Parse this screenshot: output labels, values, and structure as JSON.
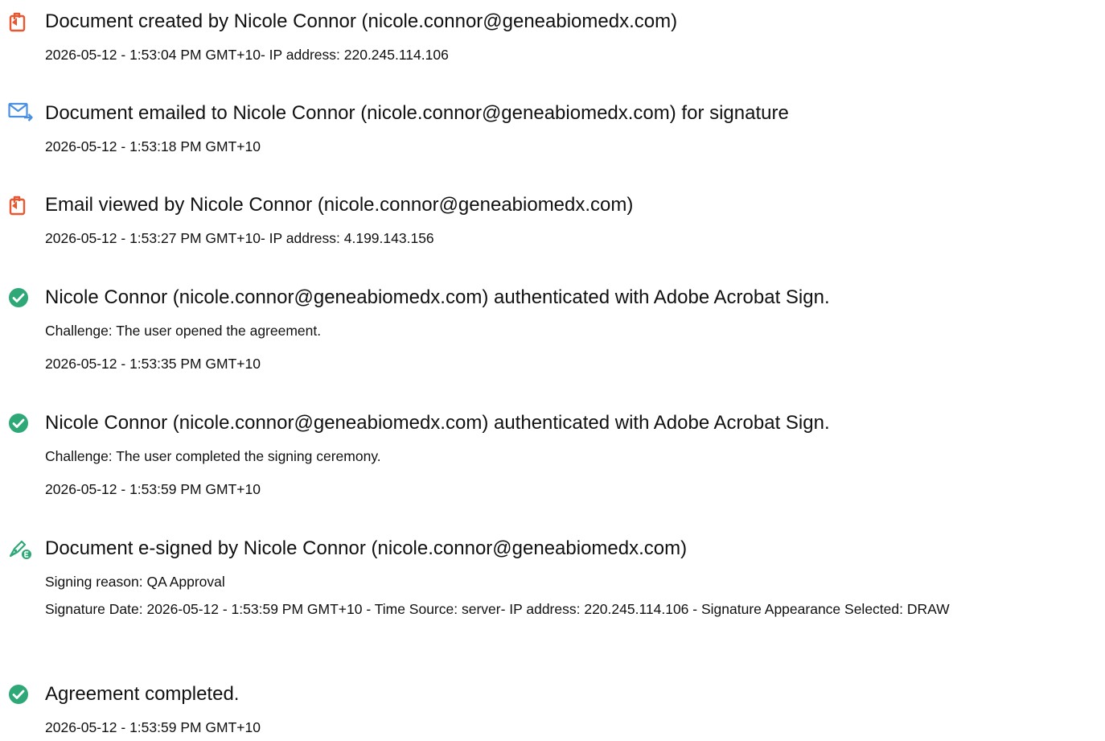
{
  "events": [
    {
      "icon": "document-created-icon",
      "title": "Document created by Nicole Connor (nicole.connor@geneabiomedx.com)",
      "lines": [
        "2026-05-12 - 1:53:04 PM GMT+10- IP address: 220.245.114.106"
      ]
    },
    {
      "icon": "email-sent-icon",
      "title": "Document emailed to Nicole Connor (nicole.connor@geneabiomedx.com) for signature",
      "lines": [
        "2026-05-12 - 1:53:18 PM GMT+10"
      ]
    },
    {
      "icon": "document-viewed-icon",
      "title": "Email viewed by Nicole Connor (nicole.connor@geneabiomedx.com)",
      "lines": [
        "2026-05-12 - 1:53:27 PM GMT+10- IP address: 4.199.143.156"
      ]
    },
    {
      "icon": "check-circle-icon",
      "title": "Nicole Connor (nicole.connor@geneabiomedx.com) authenticated with Adobe Acrobat Sign.",
      "lines": [
        "Challenge: The user opened the agreement.",
        "2026-05-12 - 1:53:35 PM GMT+10"
      ]
    },
    {
      "icon": "check-circle-icon",
      "title": "Nicole Connor (nicole.connor@geneabiomedx.com) authenticated with Adobe Acrobat Sign.",
      "lines": [
        "Challenge: The user completed the signing ceremony.",
        "2026-05-12 - 1:53:59 PM GMT+10"
      ]
    },
    {
      "icon": "e-signature-pen-icon",
      "title": "Document e-signed by Nicole Connor (nicole.connor@geneabiomedx.com)",
      "lines": [
        "Signing reason: QA Approval",
        "Signature Date: 2026-05-12 - 1:53:59 PM GMT+10 - Time Source: server- IP address: 220.245.114.106 - Signature Appearance Selected: DRAW"
      ]
    },
    {
      "icon": "check-circle-icon",
      "title": "Agreement completed.",
      "lines": [
        "2026-05-12 - 1:53:59 PM GMT+10"
      ]
    }
  ],
  "colors": {
    "document_icon": "#e8572f",
    "email_icon": "#4a90e2",
    "check_icon": "#2fa878",
    "esign_icon": "#2fa878",
    "text": "#111111"
  }
}
